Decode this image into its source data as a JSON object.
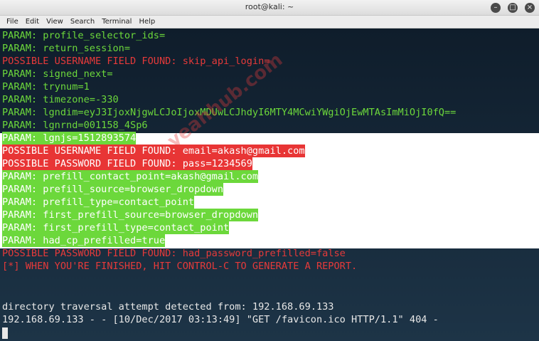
{
  "window": {
    "title": "root@kali: ~",
    "buttons": {
      "minimize": "–",
      "maximize": "□",
      "close": "×"
    }
  },
  "menubar": [
    "File",
    "Edit",
    "View",
    "Search",
    "Terminal",
    "Help"
  ],
  "terminal": {
    "lines": [
      "PARAM: profile_selector_ids=",
      "PARAM: return_session=",
      "POSSIBLE USERNAME FIELD FOUND: skip_api_login=",
      "PARAM: signed_next=",
      "PARAM: trynum=1",
      "PARAM: timezone=-330",
      "PARAM: lgndim=eyJ3IjoxNjgwLCJoIjoxMDUwLCJhdyI6MTY4MCwiYWgiOjEwMTAsImMiOjI0fQ==",
      "PARAM: lgnrnd=001158_4Sp6",
      "PARAM: lgnjs=1512893574",
      "POSSIBLE USERNAME FIELD FOUND: email=akash@gmail.com",
      "POSSIBLE PASSWORD FIELD FOUND: pass=1234569",
      "PARAM: prefill_contact_point=akash@gmail.com",
      "PARAM: prefill_source=browser_dropdown",
      "PARAM: prefill_type=contact_point",
      "PARAM: first_prefill_source=browser_dropdown",
      "PARAM: first_prefill_type=contact_point",
      "PARAM: had_cp_prefilled=true",
      "POSSIBLE PASSWORD FIELD FOUND: had_password_prefilled=false",
      "[*] WHEN YOU'RE FINISHED, HIT CONTROL-C TO GENERATE A REPORT."
    ],
    "log_lines": [
      "directory traversal attempt detected from: 192.168.69.133",
      "192.168.69.133 - - [10/Dec/2017 03:13:49] \"GET /favicon.ico HTTP/1.1\" 404 -"
    ]
  },
  "watermark": "yeahhub.com",
  "colors": {
    "param_green": "#6cd83b",
    "found_red": "#e63a3a",
    "log_white": "#e8e8e8"
  }
}
